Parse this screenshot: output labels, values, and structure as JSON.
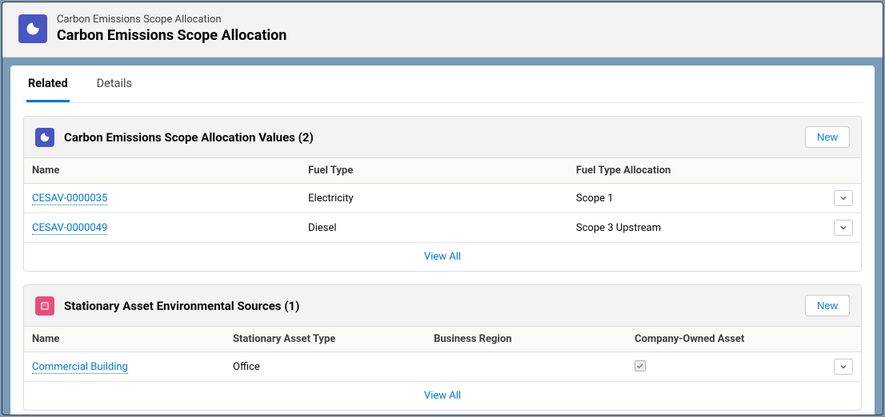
{
  "header": {
    "object_label": "Carbon Emissions Scope Allocation",
    "title": "Carbon Emissions Scope Allocation"
  },
  "tabs": {
    "related": "Related",
    "details": "Details"
  },
  "cards": {
    "values": {
      "title": "Carbon Emissions Scope Allocation Values (2)",
      "new_label": "New",
      "columns": {
        "name": "Name",
        "fuel_type": "Fuel Type",
        "fuel_alloc": "Fuel Type Allocation"
      },
      "rows": [
        {
          "name": "CESAV-0000035",
          "fuel_type": "Electricity",
          "fuel_alloc": "Scope 1"
        },
        {
          "name": "CESAV-0000049",
          "fuel_type": "Diesel",
          "fuel_alloc": "Scope 3 Upstream"
        }
      ],
      "view_all": "View All"
    },
    "sources": {
      "title": "Stationary Asset Environmental Sources (1)",
      "new_label": "New",
      "columns": {
        "name": "Name",
        "asset_type": "Stationary Asset Type",
        "region": "Business Region",
        "owned": "Company-Owned Asset"
      },
      "rows": [
        {
          "name": "Commercial Building",
          "asset_type": "Office",
          "region": "",
          "owned": true
        }
      ],
      "view_all": "View All"
    }
  }
}
